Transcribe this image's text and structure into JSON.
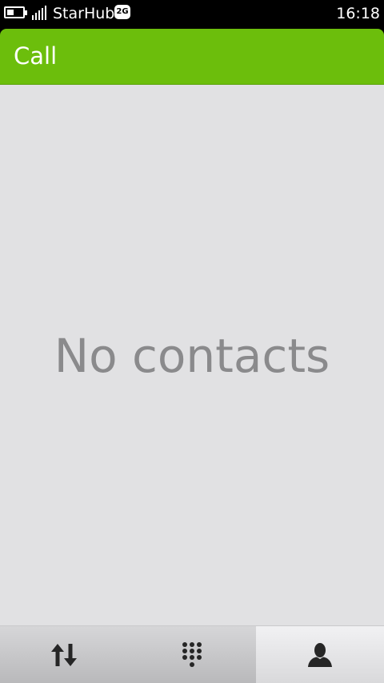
{
  "status_bar": {
    "carrier": "StarHub",
    "network_type": "2G",
    "time": "16:18",
    "battery_level": 0.45,
    "battery_icon": "battery-icon",
    "signal_icon": "signal-strength-icon"
  },
  "header": {
    "title": "Call",
    "color": "#6cbe0c"
  },
  "content": {
    "empty_message": "No contacts"
  },
  "toolbar": {
    "tabs": [
      {
        "icon": "call-log-icon",
        "active": false
      },
      {
        "icon": "dialpad-icon",
        "active": false
      },
      {
        "icon": "contacts-icon",
        "active": true
      }
    ]
  }
}
